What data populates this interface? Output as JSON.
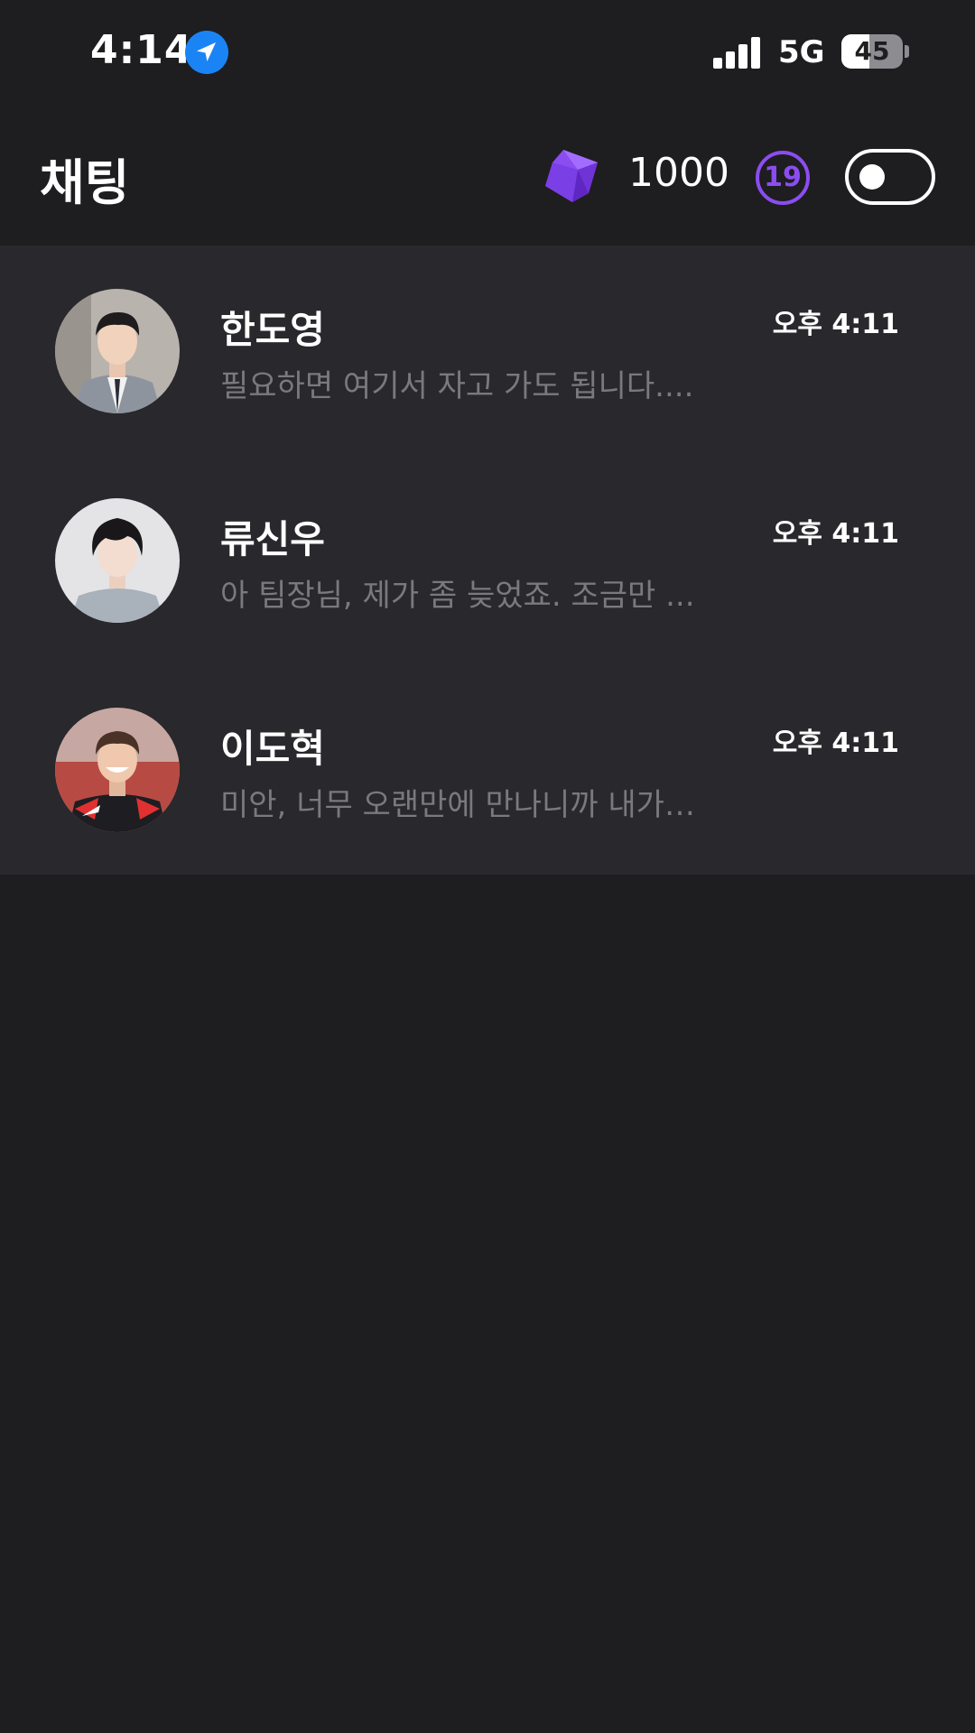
{
  "status_bar": {
    "time": "4:14",
    "network": "5G",
    "battery_level": 45,
    "battery_label": "45",
    "signal_bars": 4
  },
  "header": {
    "title": "채팅",
    "gem_count": "1000",
    "age_badge": "19",
    "toggle_on": false
  },
  "chats": [
    {
      "name": "한도영",
      "time": "오후 4:11",
      "preview": "필요하면 여기서 자고 가도 됩니다...."
    },
    {
      "name": "류신우",
      "time": "오후 4:11",
      "preview": "아 팀장님, 제가 좀 늦었죠. 조금만 ..."
    },
    {
      "name": "이도혁",
      "time": "오후 4:11",
      "preview": "미안, 너무 오랜만에 만나니까 내가…"
    }
  ],
  "icons": {
    "location": "location-arrow-icon",
    "signal": "cellular-signal-icon",
    "battery": "battery-icon",
    "gem": "gem-icon"
  },
  "colors": {
    "background": "#1e1d20",
    "list_background": "#29282c",
    "accent": "#8b4df0",
    "location_blue": "#1b84f5",
    "preview_text": "#7a797d"
  }
}
